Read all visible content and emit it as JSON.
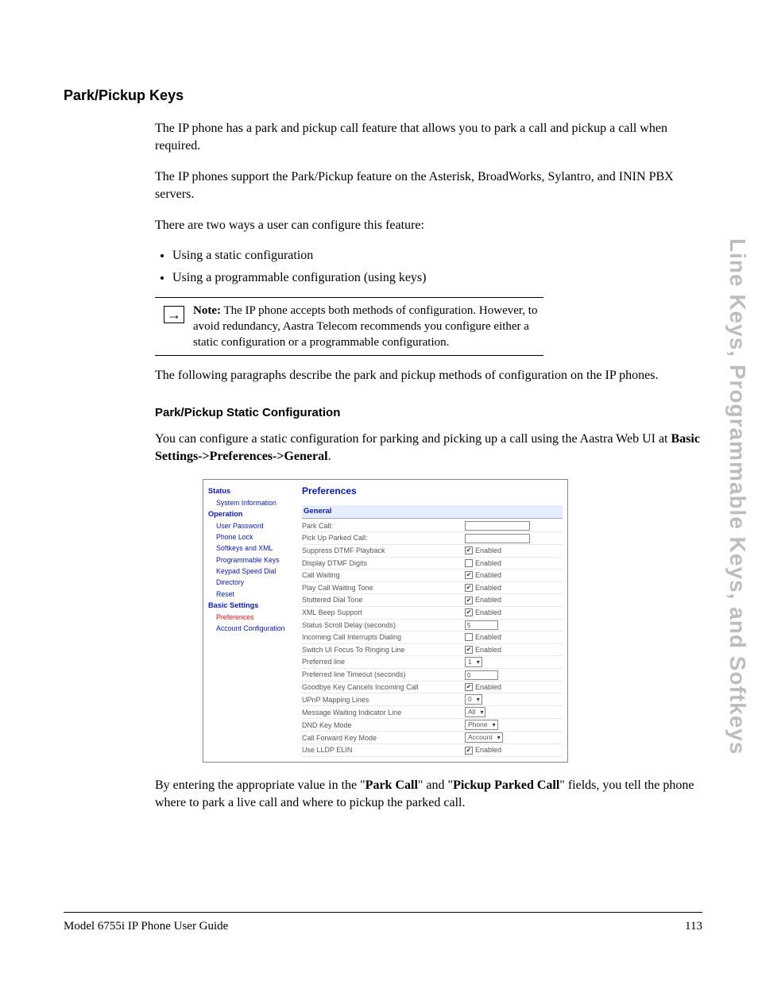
{
  "sideTab": "Line Keys, Programmable Keys, and Softkeys",
  "sectionTitle": "Park/Pickup Keys",
  "para1": "The IP phone has a park and pickup call feature that allows you to park a call and pickup a call when required.",
  "para2": "The IP phones support the Park/Pickup feature on the Asterisk, BroadWorks, Sylantro, and ININ PBX servers.",
  "para3": "There are two ways a user can configure this feature:",
  "bullets": [
    "Using a static configuration",
    "Using a programmable configuration (using keys)"
  ],
  "noteLabel": "Note:",
  "noteText": " The IP phone accepts both methods of configuration. However, to avoid redundancy, Aastra Telecom recommends you configure either a static configuration or a programmable configuration.",
  "para4": "The following paragraphs describe the park and pickup methods of configuration on the IP phones.",
  "subTitle": "Park/Pickup Static Configuration",
  "para5a": "You can configure a static configuration for parking and picking up a call using the Aastra Web UI at ",
  "para5b": "Basic Settings->Preferences->General",
  "para5c": ".",
  "para6a": "By entering the appropriate value in the \"",
  "para6b": "Park Call",
  "para6c": "\" and \"",
  "para6d": "Pickup Parked Call",
  "para6e": "\" fields, you tell the phone where to park a live call and where to pickup the parked call.",
  "webui": {
    "title": "Preferences",
    "subhead": "General",
    "nav": {
      "status": "Status",
      "sysinfo": "System Information",
      "operation": "Operation",
      "userpw": "User Password",
      "phonelock": "Phone Lock",
      "softkeys": "Softkeys and XML",
      "progkeys": "Programmable Keys",
      "keypad": "Keypad Speed Dial",
      "directory": "Directory",
      "reset": "Reset",
      "basic": "Basic Settings",
      "prefs": "Preferences",
      "acct": "Account Configuration"
    },
    "rows": [
      {
        "label": "Park Call:",
        "type": "input",
        "value": ""
      },
      {
        "label": "Pick Up Parked Call:",
        "type": "input",
        "value": ""
      },
      {
        "label": "Suppress DTMF Playback",
        "type": "check",
        "checked": true,
        "text": "Enabled"
      },
      {
        "label": "Display DTMF Digits",
        "type": "check",
        "checked": false,
        "text": "Enabled"
      },
      {
        "label": "Call Waiting",
        "type": "check",
        "checked": true,
        "text": "Enabled"
      },
      {
        "label": "Play Call Waiting Tone",
        "type": "check",
        "checked": true,
        "text": "Enabled"
      },
      {
        "label": "Stuttered Dial Tone",
        "type": "check",
        "checked": true,
        "text": "Enabled"
      },
      {
        "label": "XML Beep Support",
        "type": "check",
        "checked": true,
        "text": "Enabled"
      },
      {
        "label": "Status Scroll Delay (seconds)",
        "type": "inputsm",
        "value": "5"
      },
      {
        "label": "Incoming Call Interrupts Dialing",
        "type": "check",
        "checked": false,
        "text": "Enabled"
      },
      {
        "label": "Switch UI Focus To Ringing Line",
        "type": "check",
        "checked": true,
        "text": "Enabled"
      },
      {
        "label": "Preferred line",
        "type": "select",
        "value": "1"
      },
      {
        "label": "Preferred line Timeout (seconds)",
        "type": "inputsm",
        "value": "0"
      },
      {
        "label": "Goodbye Key Cancels Incoming Call",
        "type": "check",
        "checked": true,
        "text": "Enabled"
      },
      {
        "label": "UPnP Mapping Lines",
        "type": "select",
        "value": "0"
      },
      {
        "label": "Message Waiting Indicator Line",
        "type": "select",
        "value": "All"
      },
      {
        "label": "DND Key Mode",
        "type": "select",
        "value": "Phone"
      },
      {
        "label": "Call Forward Key Mode",
        "type": "select",
        "value": "Account"
      },
      {
        "label": "Use LLDP ELIN",
        "type": "check",
        "checked": true,
        "text": "Enabled"
      }
    ]
  },
  "footerLeft": "Model 6755i IP Phone User Guide",
  "footerRight": "113"
}
